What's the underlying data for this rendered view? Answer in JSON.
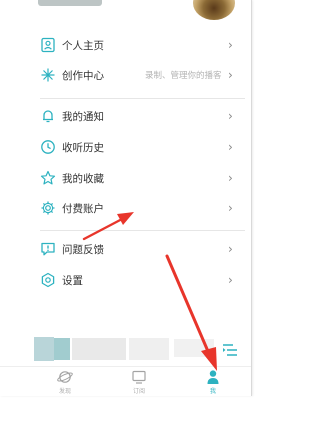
{
  "accent_color": "#2db2c0",
  "arrow_color": "#e8352b",
  "menu": [
    {
      "key": "profile",
      "label": "个人主页",
      "icon": "person-card-icon",
      "hint": ""
    },
    {
      "key": "creator",
      "label": "创作中心",
      "icon": "sparkle-icon",
      "hint": "录制、管理你的播客"
    },
    {
      "key": "notifications",
      "label": "我的通知",
      "icon": "bell-icon",
      "hint": ""
    },
    {
      "key": "history",
      "label": "收听历史",
      "icon": "clock-icon",
      "hint": ""
    },
    {
      "key": "favorites",
      "label": "我的收藏",
      "icon": "star-icon",
      "hint": ""
    },
    {
      "key": "paid",
      "label": "付费账户",
      "icon": "gear-icon",
      "hint": ""
    },
    {
      "key": "feedback",
      "label": "问题反馈",
      "icon": "feedback-icon",
      "hint": ""
    },
    {
      "key": "settings",
      "label": "设置",
      "icon": "settings-icon",
      "hint": ""
    }
  ],
  "chevron": "›",
  "tabs": [
    {
      "key": "discover",
      "label": "发现",
      "icon": "planet-icon",
      "active": false
    },
    {
      "key": "subscriptions",
      "label": "订阅",
      "icon": "tv-icon",
      "active": false
    },
    {
      "key": "me",
      "label": "我",
      "icon": "person-icon",
      "active": true
    }
  ]
}
